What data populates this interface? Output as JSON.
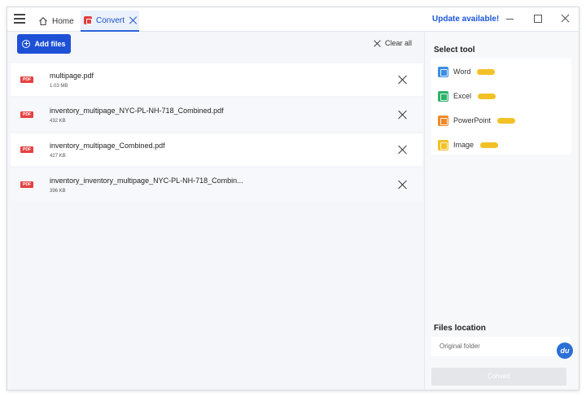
{
  "titlebar": {
    "tabs": [
      {
        "label": "Home",
        "icon": "home-icon"
      },
      {
        "label": "Convert",
        "icon": "convert-icon",
        "active": true
      }
    ],
    "update_label": "Update available!"
  },
  "toolbar": {
    "add_files_label": "Add files",
    "clear_all_label": "Clear all"
  },
  "files": [
    {
      "name": "multipage.pdf",
      "size": "1.03 MB",
      "type_label": "PDF"
    },
    {
      "name": "inventory_multipage_NYC-PL-NH-718_Combined.pdf",
      "size": "432 KB",
      "type_label": "PDF"
    },
    {
      "name": "inventory_multipage_Combined.pdf",
      "size": "427 KB",
      "type_label": "PDF"
    },
    {
      "name": "inventory_inventory_multipage_NYC-PL-NH-718_Combin...",
      "size": "396 KB",
      "type_label": "PDF"
    }
  ],
  "sidebar": {
    "select_tool_title": "Select tool",
    "tools": [
      {
        "label": "Word",
        "color": "#3b8ee0",
        "pill_color": "#f2c125"
      },
      {
        "label": "Excel",
        "color": "#2fb36a",
        "pill_color": "#f2c125"
      },
      {
        "label": "PowerPoint",
        "color": "#ee8a2a",
        "pill_color": "#f2c125"
      },
      {
        "label": "Image",
        "color": "#f2c125",
        "pill_color": "#f2c125"
      }
    ],
    "files_location_title": "Files location",
    "location_value": "Original folder",
    "badge_text": "du",
    "convert_label": "Convert"
  },
  "colors": {
    "accent": "#1e50d6",
    "pdf_red": "#e64242"
  }
}
